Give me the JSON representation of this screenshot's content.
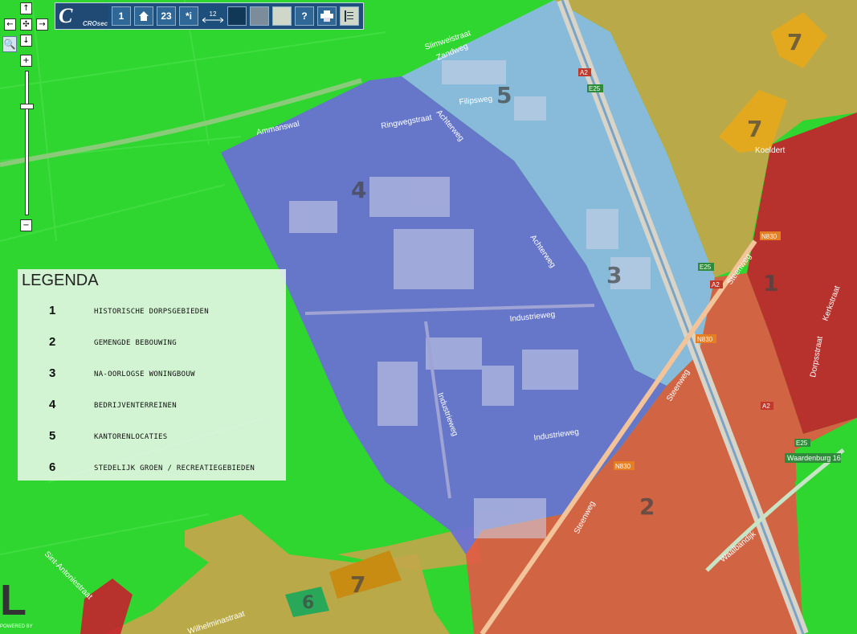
{
  "toolbar": {
    "logo_letter": "C",
    "logo_text": "CROsec",
    "btn_page1": "1",
    "btn_pages": "23",
    "btn_info": "*i",
    "scale_value": "12",
    "btn_help": "?"
  },
  "nav": {
    "up": "↑",
    "left": "←",
    "center": "✣",
    "right": "→",
    "down": "↓",
    "zoom_in": "+",
    "zoom_out": "−",
    "zoom_box": "🔍"
  },
  "legend": {
    "title": "LEGENDA",
    "items": [
      {
        "num": "1",
        "label": "HISTORISCHE DORPSGEBIEDEN"
      },
      {
        "num": "2",
        "label": "GEMENGDE BEBOUWING"
      },
      {
        "num": "3",
        "label": "NA-OORLOGSE WONINGBOUW"
      },
      {
        "num": "4",
        "label": "BEDRIJVENTERREINEN"
      },
      {
        "num": "5",
        "label": "KANTORENLOCATIES"
      },
      {
        "num": "6",
        "label": "STEDELIJK GROEN / RECREATIEGEBIEDEN"
      }
    ]
  },
  "map": {
    "zone_colors": {
      "groen": "#2fd62f",
      "bedrijven": "#6b6fd8",
      "kantoren": "#8fb8e8",
      "gemengd": "#e05a45",
      "historisch": "#c8202e",
      "naoorlogs": "#c2a64a",
      "zone7": "#e8a81a"
    },
    "zone_numbers": [
      "1",
      "2",
      "3",
      "4",
      "5",
      "6",
      "7",
      "7",
      "7"
    ],
    "road_labels": {
      "slimweistraat": "Slimweistraat",
      "zandweg": "Zandweg",
      "ammanswal": "Ammanswal",
      "ringweg": "Ringwegstraat",
      "achterweg1": "Achterweg",
      "achterweg2": "Achterweg",
      "industrieweg1": "Industrieweg",
      "industrieweg2": "Industrieweg",
      "industrieweg3": "Industrieweg",
      "steenweg1": "Steenweg",
      "steenweg2": "Steenweg",
      "steenweg3": "Steenweg",
      "waalbandijk": "Waalbandijk",
      "wilhelmina": "Wilhelminastraat",
      "koeldert": "Koeldert",
      "kerkstraat": "Kerkstraat",
      "dorpsstraat": "Dorpsstraat",
      "sintantonie": "Sint-Antoniestraat",
      "filips": "Filipsweg"
    },
    "shields": {
      "a2_top": "A2",
      "e25_top": "E25",
      "n830_a": "N830",
      "n830_b": "N830",
      "n830_c": "N830",
      "e25_mid": "E25",
      "a2_mid": "A2",
      "a2_low": "A2",
      "e25_low": "E25",
      "exit": "Waardenburg 16"
    },
    "corner_logo": "L",
    "powered": "POWERED BY"
  }
}
